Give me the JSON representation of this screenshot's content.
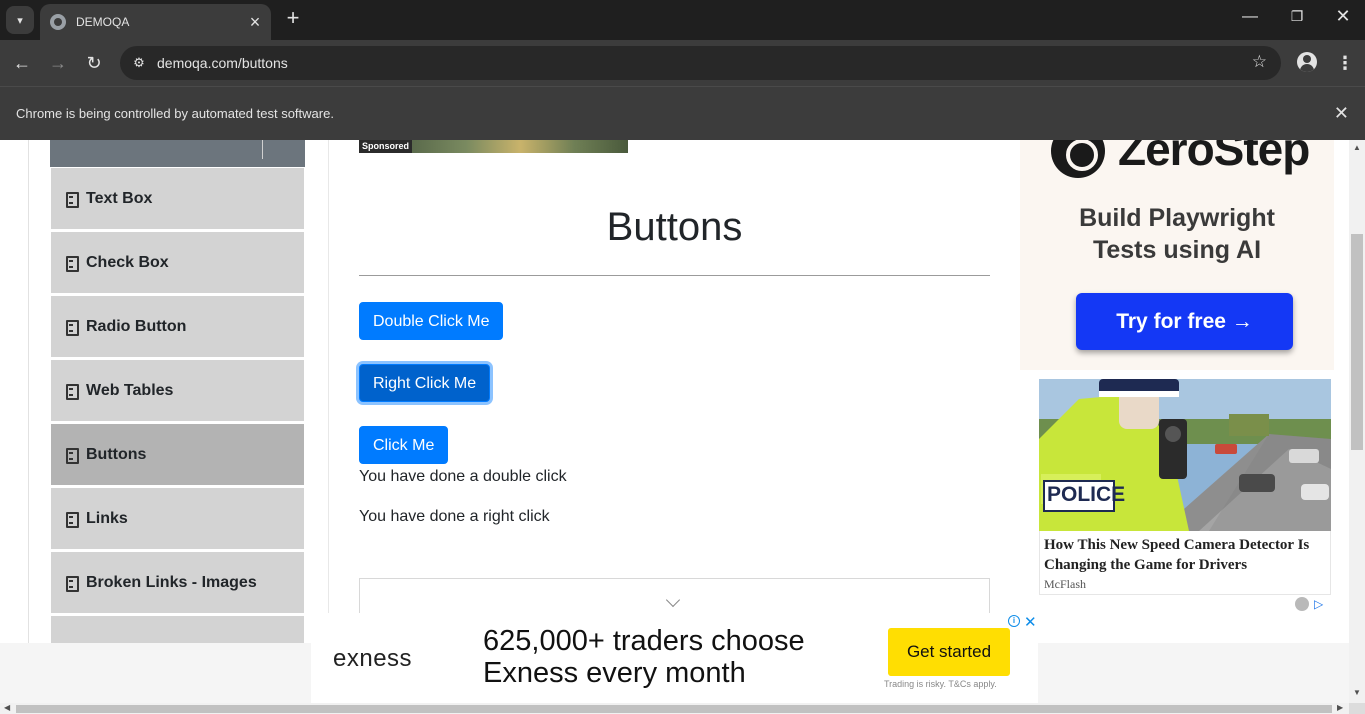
{
  "browser": {
    "tab_title": "DEMOQA",
    "url": "demoqa.com/buttons",
    "infobar_text": "Chrome is being controlled by automated test software."
  },
  "sidebar": {
    "items": [
      {
        "label": "Text Box",
        "active": false
      },
      {
        "label": "Check Box",
        "active": false
      },
      {
        "label": "Radio Button",
        "active": false
      },
      {
        "label": "Web Tables",
        "active": false
      },
      {
        "label": "Buttons",
        "active": true
      },
      {
        "label": "Links",
        "active": false
      },
      {
        "label": "Broken Links - Images",
        "active": false
      }
    ]
  },
  "main": {
    "sponsored_label": "Sponsored",
    "title": "Buttons",
    "buttons": {
      "double_click": "Double Click Me",
      "right_click": "Right Click Me",
      "click": "Click Me"
    },
    "messages": {
      "double_click": "You have done a double click",
      "right_click": "You have done a right click"
    }
  },
  "ads": {
    "zerostep": {
      "brand": "ZeroStep",
      "tagline_line1": "Build Playwright",
      "tagline_line2": "Tests using AI",
      "cta": "Try for free →"
    },
    "police": {
      "badge": "POLICE",
      "title": "How This New Speed Camera Detector Is Changing the Game for Drivers",
      "source": "McFlash"
    },
    "exness": {
      "logo": "exness",
      "headline_line1": "625,000+ traders choose",
      "headline_line2": "Exness every month",
      "cta": "Get started",
      "disclaimer": "Trading is risky. T&Cs apply."
    }
  },
  "colors": {
    "primary_button": "#007bff",
    "sidebar_bg": "#d3d3d3",
    "sidebar_active_bg": "#b3b3b3",
    "zerostep_cta": "#1438f5",
    "exness_cta": "#ffde02"
  }
}
